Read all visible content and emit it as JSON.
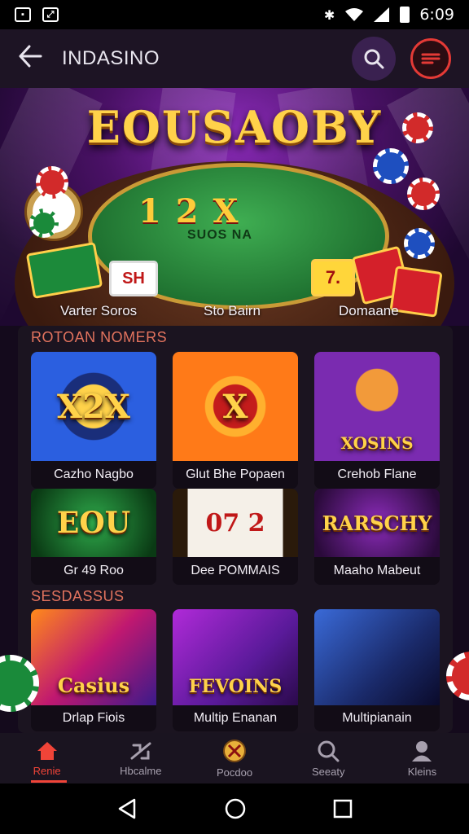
{
  "status_bar": {
    "time": "6:09",
    "left_icons": [
      "gallery-icon",
      "photo-icon"
    ],
    "right_icons": [
      "vibrate-icon",
      "wifi-icon",
      "signal-icon",
      "battery-icon"
    ]
  },
  "app_bar": {
    "title": "INDASINO",
    "back_icon": "arrow-left-icon",
    "search_icon": "search-icon",
    "menu_icon": "menu-icon",
    "accent": "#e43a36"
  },
  "hero": {
    "title": "EOUSAOBY",
    "felt_numbers": "1 2 X",
    "felt_subtitle": "SUOS NA",
    "card_text_left": "SH",
    "card_text_right": "7.",
    "labels": [
      "Varter Soros",
      "Sto Bairn",
      "Domaane"
    ]
  },
  "sections": [
    {
      "title": "ROTOAN NOMERS",
      "tiles": [
        {
          "art": "X2X",
          "label": "Cazho Nagbo"
        },
        {
          "art": "X",
          "label": "Glut Bhe Popaen"
        },
        {
          "art": "XOSINS",
          "label": "Crehob Flane"
        },
        {
          "art": "EOU",
          "label": "Gr 49 Roo"
        },
        {
          "art": "07 2",
          "label": "Dee POMMAIS"
        },
        {
          "art": "RARSCHY",
          "label": "Maaho Mabeut"
        }
      ]
    },
    {
      "title": "SESDASSUS",
      "tiles": [
        {
          "art": "Casius",
          "label": "Drlap Fiois"
        },
        {
          "art": "FEVOINS",
          "label": "Multip Enanan"
        },
        {
          "art": "",
          "label": "Multipianain"
        }
      ]
    }
  ],
  "bottom_nav": [
    {
      "label": "Renie",
      "icon": "home-icon",
      "active": true
    },
    {
      "label": "Hbcalme",
      "icon": "promotions-icon",
      "active": false
    },
    {
      "label": "Pocdoo",
      "icon": "games-icon",
      "active": false
    },
    {
      "label": "Seeaty",
      "icon": "search-icon",
      "active": false
    },
    {
      "label": "Kleins",
      "icon": "profile-icon",
      "active": false
    }
  ],
  "system_nav": [
    "back-triangle-icon",
    "home-circle-icon",
    "recents-square-icon"
  ],
  "colors": {
    "accent_red": "#f04438",
    "gold": "#ffd24a",
    "section_title": "#e2735e",
    "panel": "#1b1420"
  }
}
